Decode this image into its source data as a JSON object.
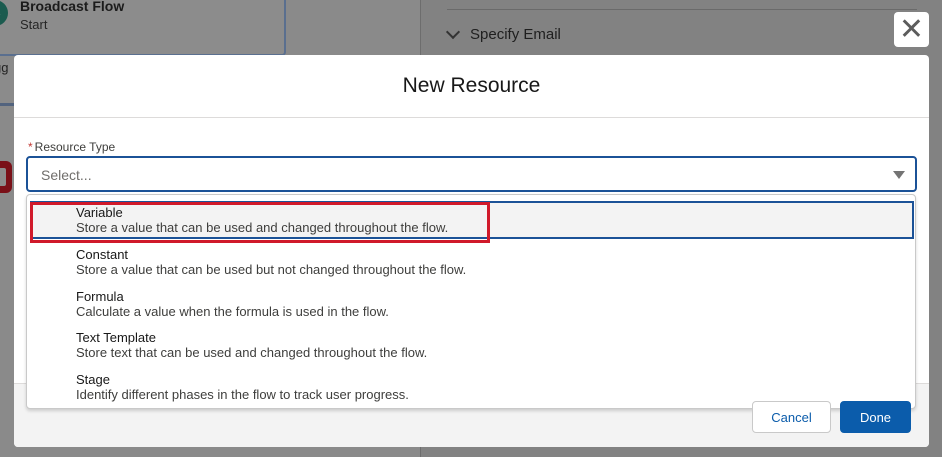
{
  "background": {
    "flow_card": {
      "title": "Broadcast Flow",
      "subtitle": "Start"
    },
    "partial_text": "gg",
    "right_panel": {
      "section_label": "Specify Email"
    }
  },
  "modal": {
    "title": "New Resource",
    "close_label": "✕",
    "field": {
      "required_marker": "*",
      "label": "Resource Type",
      "placeholder": "Select..."
    },
    "options": [
      {
        "title": "Variable",
        "description": "Store a value that can be used and changed throughout the flow."
      },
      {
        "title": "Constant",
        "description": "Store a value that can be used but not changed throughout the flow."
      },
      {
        "title": "Formula",
        "description": "Calculate a value when the formula is used in the flow."
      },
      {
        "title": "Text Template",
        "description": "Store text that can be used and changed throughout the flow."
      },
      {
        "title": "Stage",
        "description": "Identify different phases in the flow to track user progress."
      }
    ],
    "footer": {
      "cancel_label": "Cancel",
      "done_label": "Done"
    }
  },
  "colors": {
    "accent": "#0b5cab",
    "focus_border": "#1b5297",
    "highlight": "#d0192a",
    "required": "#c23934"
  }
}
